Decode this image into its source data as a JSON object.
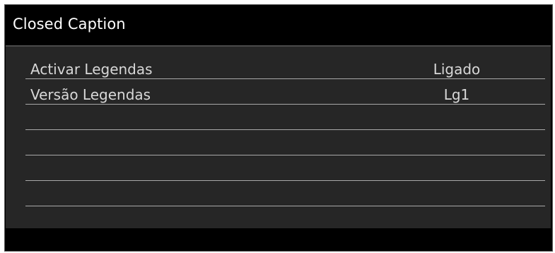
{
  "menu": {
    "title": "Closed Caption",
    "items": [
      {
        "label": "Activar Legendas",
        "value": "Ligado"
      },
      {
        "label": "Versão Legendas",
        "value": "Lg1"
      },
      {
        "label": "",
        "value": ""
      },
      {
        "label": "",
        "value": ""
      },
      {
        "label": "",
        "value": ""
      },
      {
        "label": "",
        "value": ""
      }
    ]
  },
  "colors": {
    "header_bg": "#000000",
    "body_bg": "#262626",
    "text": "#d8d8d8",
    "divider": "#a9a9a9"
  }
}
